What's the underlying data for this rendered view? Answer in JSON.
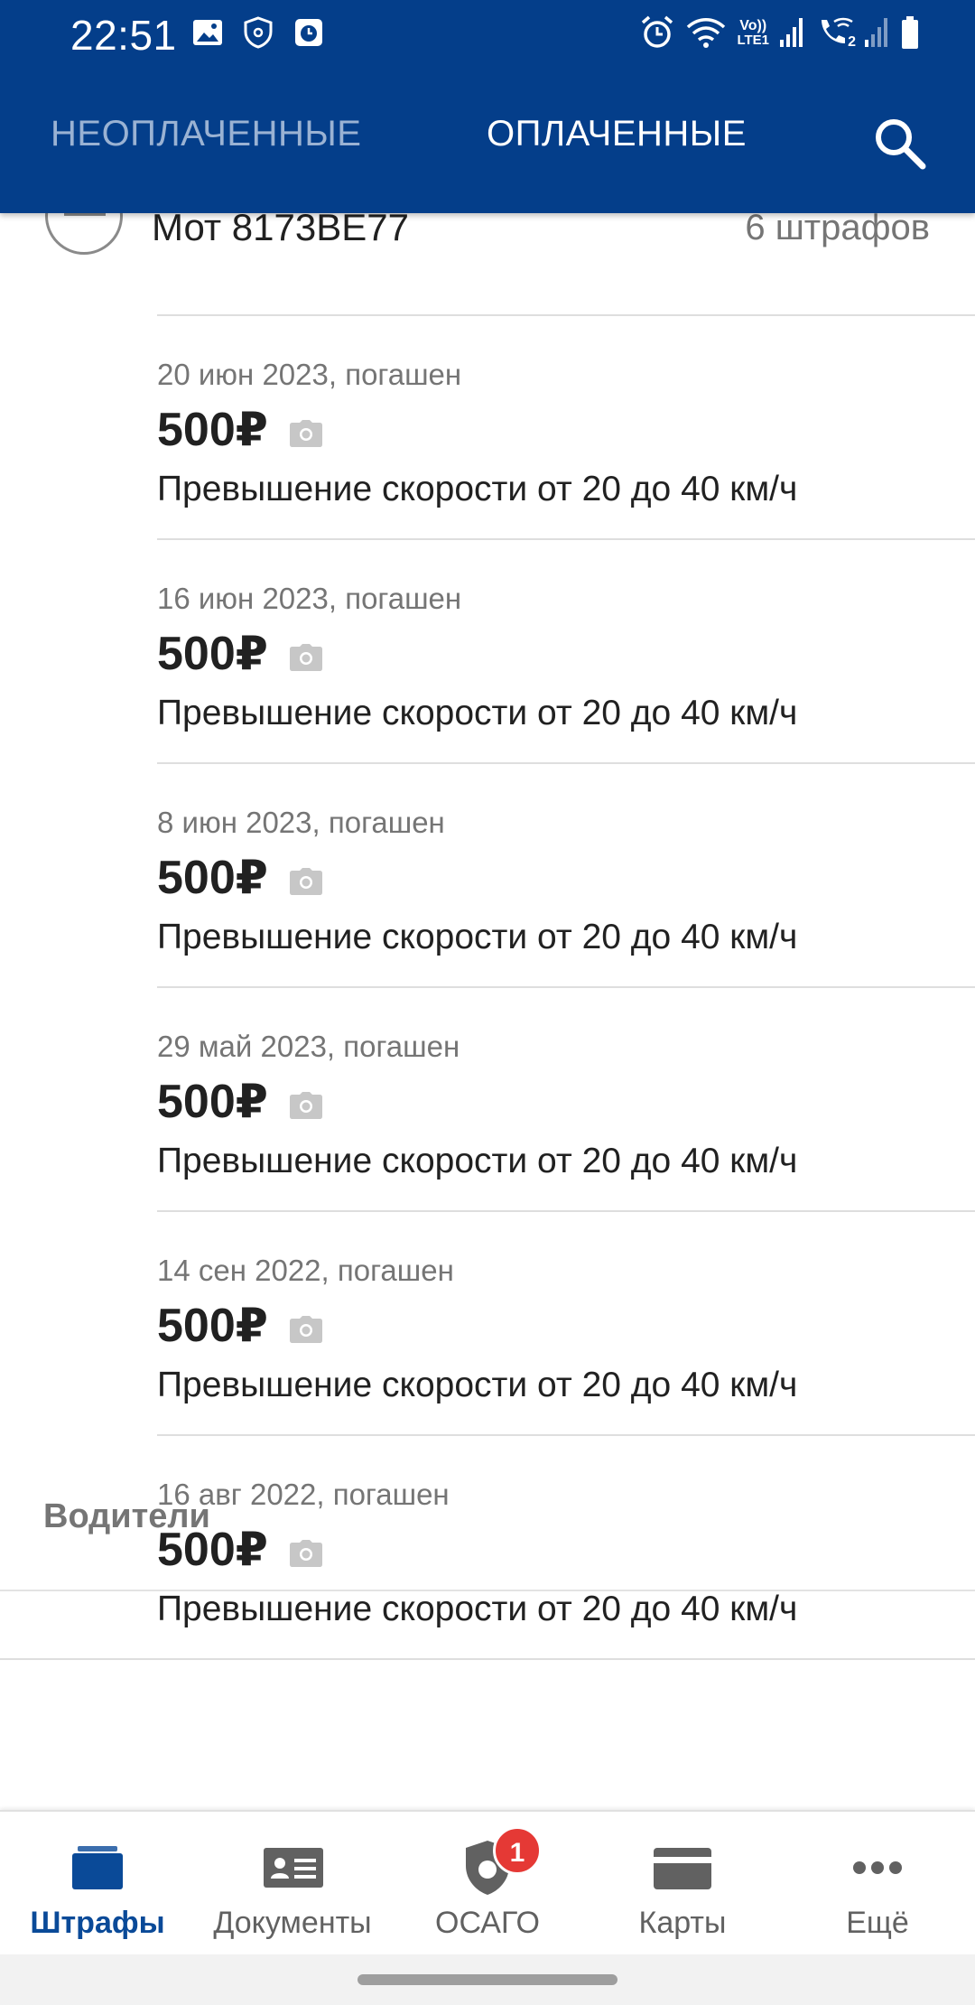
{
  "status_bar": {
    "time": "22:51",
    "icons_left": [
      "image-icon",
      "shield-notification-icon",
      "clock-app-icon"
    ],
    "icons_right": [
      "alarm-icon",
      "wifi-icon",
      "volte-lte1-icon",
      "signal-icon",
      "wifi-call-icon",
      "signal-2-icon",
      "battery-icon"
    ],
    "volte_label": "Vo))",
    "lte_label": "LTE1",
    "sim2_label": "2"
  },
  "app_bar": {
    "tabs": [
      {
        "label": "НЕОПЛАЧЕННЫЕ",
        "active": false
      },
      {
        "label": "ОПЛАЧЕННЫЕ",
        "active": true
      }
    ],
    "search_icon": "search-icon",
    "color": "#043E8A"
  },
  "vehicle": {
    "name": "Мот 8173ВЕ77",
    "count": "6 штрафов"
  },
  "fines": [
    {
      "date": "20 июн 2023, погашен",
      "amount": "500₽",
      "description": "Превышение скорости от 20 до 40 км/ч"
    },
    {
      "date": "16 июн 2023, погашен",
      "amount": "500₽",
      "description": "Превышение скорости от 20 до 40 км/ч"
    },
    {
      "date": "8 июн 2023, погашен",
      "amount": "500₽",
      "description": "Превышение скорости от 20 до 40 км/ч"
    },
    {
      "date": "29 май 2023, погашен",
      "amount": "500₽",
      "description": "Превышение скорости от 20 до 40 км/ч"
    },
    {
      "date": "14 сен 2022, погашен",
      "amount": "500₽",
      "description": "Превышение скорости от 20 до 40 км/ч"
    },
    {
      "date": "16 авг 2022, погашен",
      "amount": "500₽",
      "description": "Превышение скорости от 20 до 40 км/ч"
    }
  ],
  "drivers_section": {
    "label": "Водители"
  },
  "bottom_nav": {
    "items": [
      {
        "label": "Штрафы",
        "icon": "fines-icon",
        "active": true
      },
      {
        "label": "Документы",
        "icon": "documents-icon",
        "active": false
      },
      {
        "label": "ОСАГО",
        "icon": "osago-shield-icon",
        "active": false,
        "badge": "1"
      },
      {
        "label": "Карты",
        "icon": "cards-icon",
        "active": false
      },
      {
        "label": "Ещё",
        "icon": "more-icon",
        "active": false
      }
    ]
  },
  "colors": {
    "primary": "#043E8A",
    "active_nav": "#0A4A98",
    "badge": "#E53935"
  }
}
